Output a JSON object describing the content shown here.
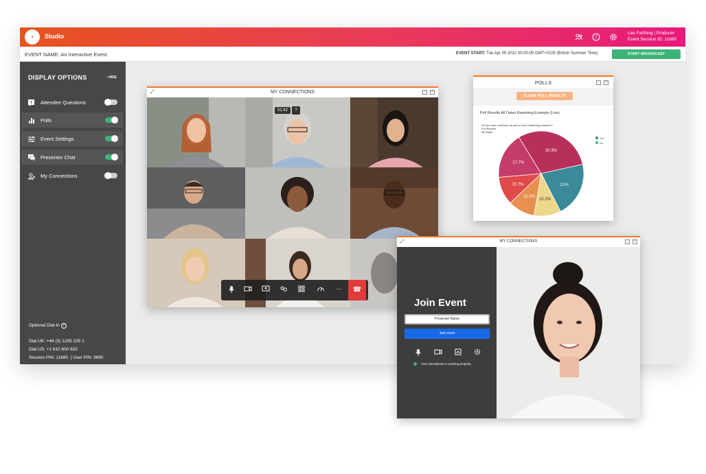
{
  "topbar": {
    "logo_text": "Studio",
    "app_name": "Studio",
    "user_name": "Lee Farthing",
    "user_role": "Producer",
    "session_id": "Event Session ID: 11680"
  },
  "subbar": {
    "event_label": "EVENT NAME:",
    "event_name": "An Interactive Event",
    "start_label": "EVENT START:",
    "start_value": "Tue Apr 05 2022 00:00:00 GMT+0100 (British Summer Time)",
    "broadcast_button": "START BROADCAST"
  },
  "sidebar": {
    "title": "DISPLAY OPTIONS",
    "hide_label": "HIDE",
    "items": [
      {
        "label": "Attendee Questions",
        "icon": "question-icon",
        "enabled": false
      },
      {
        "label": "Polls",
        "icon": "bar-chart-icon",
        "enabled": true
      },
      {
        "label": "Event Settings",
        "icon": "sliders-icon",
        "enabled": true
      },
      {
        "label": "Presenter Chat",
        "icon": "chat-icon",
        "enabled": true
      },
      {
        "label": "My Connections",
        "icon": "people-icon",
        "enabled": false
      }
    ],
    "dial_title": "Optional Dial-In",
    "dial_uk": "Dial UK: +44 (0) 1295 235 1",
    "dial_us": "Dial US: +1 610 600 632",
    "session_pin": "Session PIN: 11680",
    "user_pin": "User PIN: 9690"
  },
  "connections": {
    "title": "MY CONNECTIONS",
    "timer": "01:42",
    "controls": [
      "mic-icon",
      "camera-icon",
      "screen-share-icon",
      "layout-icon",
      "grid-icon",
      "speed-icon",
      "more-icon",
      "hangup-icon"
    ]
  },
  "polls": {
    "title": "POLLS",
    "clear_button": "CLEAR POLL RESULTS",
    "subtitle": "Poll Results All Dates Reporting Example (Live)",
    "question": "Do you have webinars as part of your marketing outreach?",
    "q_line2": "Poll Results",
    "q_line3": "All Dates",
    "legend_yes": "Yes",
    "legend_no": "No"
  },
  "chart_data": {
    "type": "pie",
    "values": [
      30.3,
      21,
      10.2,
      10.2,
      10.7,
      17.7
    ],
    "labels": [
      "30.3%",
      "21%",
      "10.2%",
      "10.2%",
      "10.7%",
      "17.7%"
    ],
    "colors": [
      "#b8305a",
      "#3a8a9a",
      "#ecd78a",
      "#e8904e",
      "#e04a4a",
      "#c43c6a"
    ]
  },
  "join": {
    "window_title": "MY CONNECTIONS",
    "title": "Join Event",
    "name_placeholder": "Presenter Name",
    "join_button": "Join event",
    "mic_status": "Your microphone is working properly"
  }
}
